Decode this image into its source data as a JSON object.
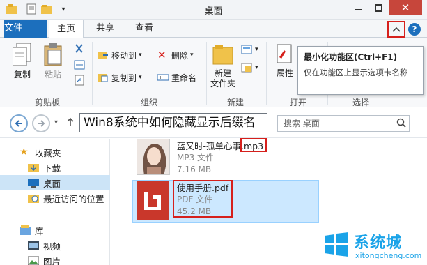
{
  "window": {
    "title": "桌面"
  },
  "ribbon_tabs": [
    "文件",
    "主页",
    "共享",
    "查看"
  ],
  "groups": {
    "clipboard": {
      "label": "剪贴板",
      "copy": "复制",
      "paste": "粘贴"
    },
    "organize": {
      "label": "组织",
      "move_to": "移动到",
      "copy_to": "复制到",
      "delete": "删除",
      "rename": "重命名"
    },
    "new": {
      "label": "新建",
      "new_folder": "新建\n文件夹"
    },
    "open": {
      "label": "打开",
      "properties": "属性"
    },
    "select": {
      "label": "选择"
    }
  },
  "tooltip": {
    "title": "最小化功能区(Ctrl+F1)",
    "description": "仅在功能区上显示选项卡名称"
  },
  "address": {
    "path": "Win8系统中如何隐藏显示后缀名",
    "search_placeholder": "搜索 桌面"
  },
  "nav": {
    "favorites": "收藏夹",
    "downloads": "下载",
    "desktop": "桌面",
    "recent": "最近访问的位置",
    "libraries": "库",
    "videos": "视频",
    "pictures": "图片"
  },
  "files": [
    {
      "name_base": "蓝又时-孤单心事",
      "name_ext": ".mp3",
      "type": "MP3 文件",
      "size": "7.16 MB"
    },
    {
      "name_base": "使用手册",
      "name_ext": ".pdf",
      "type": "PDF 文件",
      "size": "45.2 MB"
    }
  ],
  "watermark": {
    "text": "系统城",
    "url": "xitongcheng.com"
  },
  "colors": {
    "accent": "#1c6fbd",
    "highlight_red": "#d6201c",
    "selection": "#cce8ff"
  }
}
